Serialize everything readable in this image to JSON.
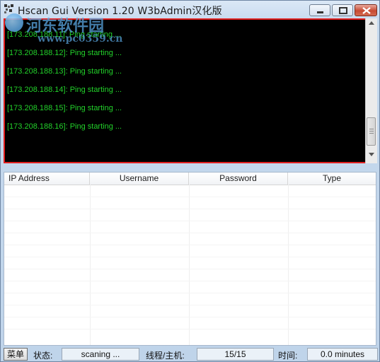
{
  "window": {
    "title": "Hscan Gui Version 1.20 W3bAdmin汉化版",
    "accent_border": "#e11f1f",
    "console_bg": "#000000",
    "console_text": "#22d12a"
  },
  "watermark": {
    "text": "河东软件园",
    "url": "www.pc0359.cn"
  },
  "console": {
    "lines": [
      "[173.208.188.11]: Ping starting ...",
      "[173.208.188.12]: Ping starting ...",
      "[173.208.188.13]: Ping starting ...",
      "[173.208.188.14]: Ping starting ...",
      "[173.208.188.15]: Ping starting ...",
      "[173.208.188.16]: Ping starting ..."
    ]
  },
  "table": {
    "columns": [
      "IP Address",
      "Username",
      "Password",
      "Type"
    ]
  },
  "statusbar": {
    "menu_label": "菜单",
    "status_label": "状态:",
    "status_value": "scaning ...",
    "threads_label": "线程/主机:",
    "threads_value": "15/15",
    "time_label": "时间:",
    "time_value": "0.0 minutes"
  },
  "icons": [
    "app-icon",
    "minimize-icon",
    "maximize-icon",
    "close-icon",
    "scroll-up-icon",
    "scroll-down-icon"
  ]
}
